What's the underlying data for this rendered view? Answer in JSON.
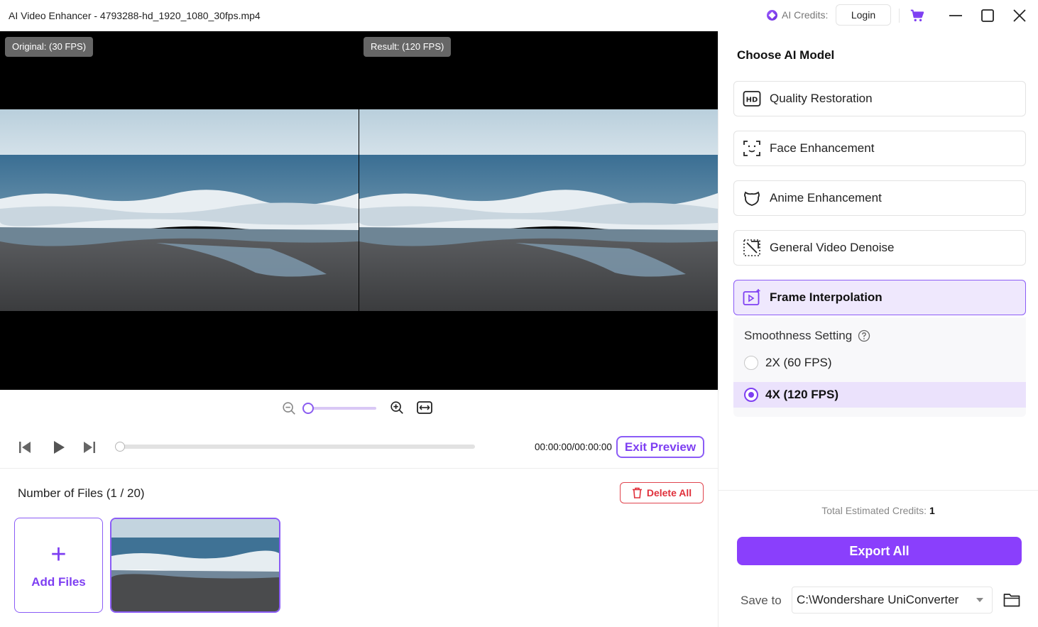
{
  "window": {
    "title": "AI Video Enhancer - 4793288-hd_1920_1080_30fps.mp4",
    "credits_label": "AI Credits:",
    "login_label": "Login",
    "icons": [
      "cart-icon",
      "minimize-icon",
      "maximize-icon",
      "close-icon"
    ]
  },
  "preview": {
    "original_label": "Original: (30 FPS)",
    "result_label": "Result: (120 FPS)",
    "timecode": "00:00:00/00:00:00",
    "exit_label": "Exit Preview",
    "zoom_level": 0,
    "playback_progress": 0
  },
  "files": {
    "title": "Number of Files (1 / 20)",
    "delete_label": "Delete All",
    "add_label": "Add Files"
  },
  "panel": {
    "title": "Choose AI Model",
    "models": [
      {
        "label": "Quality Restoration",
        "icon": "hd-icon"
      },
      {
        "label": "Face Enhancement",
        "icon": "face-scan-icon"
      },
      {
        "label": "Anime Enhancement",
        "icon": "anime-face-icon"
      },
      {
        "label": "General Video Denoise",
        "icon": "denoise-icon"
      },
      {
        "label": "Frame Interpolation",
        "icon": "frame-interpolation-icon",
        "selected": true
      }
    ],
    "smoothness": {
      "title": "Smoothness Setting",
      "options": [
        {
          "label": "2X (60 FPS)",
          "selected": false
        },
        {
          "label": "4X (120 FPS)",
          "selected": true
        }
      ]
    },
    "estimated_label": "Total Estimated Credits:",
    "estimated_value": "1",
    "export_label": "Export All",
    "save_to_label": "Save to",
    "save_to_value": "C:\\Wondershare UniConverter"
  },
  "colors": {
    "accent": "#8a3ffc",
    "accent_light": "#efe8fd",
    "danger": "#e0303b"
  }
}
